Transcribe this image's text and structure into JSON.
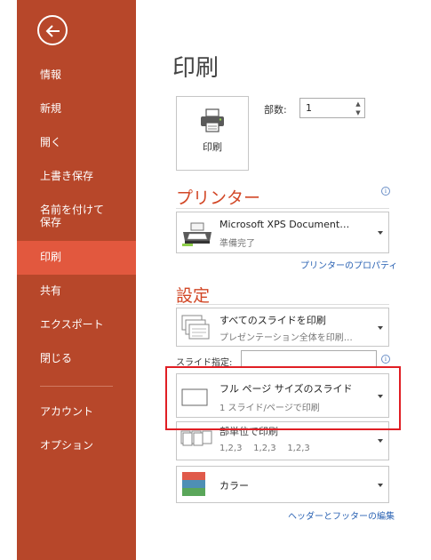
{
  "sidebar": {
    "back_icon": "arrow-left-icon",
    "items": [
      {
        "label": "情報"
      },
      {
        "label": "新規"
      },
      {
        "label": "開く"
      },
      {
        "label": "上書き保存"
      },
      {
        "label": "名前を付けて\n保存"
      },
      {
        "label": "印刷"
      },
      {
        "label": "共有"
      },
      {
        "label": "エクスポート"
      },
      {
        "label": "閉じる"
      },
      {
        "label": "アカウント"
      },
      {
        "label": "オプション"
      }
    ],
    "active_index": 5
  },
  "main": {
    "title": "印刷",
    "print_button": {
      "label": "印刷",
      "icon": "printer-icon"
    },
    "copies": {
      "label": "部数:",
      "value": "1"
    },
    "printer_section": {
      "heading": "プリンター",
      "printer_name": "Microsoft XPS Document…",
      "printer_status": "準備完了",
      "properties_link": "プリンターのプロパティ"
    },
    "settings_section": {
      "heading": "設定",
      "slides_range": {
        "title": "すべてのスライドを印刷",
        "subtitle": "プレゼンテーション全体を印刷…"
      },
      "slide_spec_label": "スライド指定:",
      "slide_spec_value": "",
      "layout": {
        "title": "フル ページ サイズのスライド",
        "subtitle": "1 スライド/ページで印刷"
      },
      "collate": {
        "title": "部単位で印刷",
        "subtitle": "1,2,3    1,2,3    1,2,3"
      },
      "color": {
        "title": "カラー",
        "swatch_colors": [
          "#e05a4a",
          "#4e8fb5",
          "#5aa65a"
        ]
      },
      "header_footer_link": "ヘッダーとフッターの編集"
    }
  },
  "colors": {
    "sidebar_bg": "#b7472a",
    "active_item_bg": "#e2583e",
    "accent": "#d24726",
    "link": "#2a62b3",
    "highlight": "#e01e24"
  }
}
